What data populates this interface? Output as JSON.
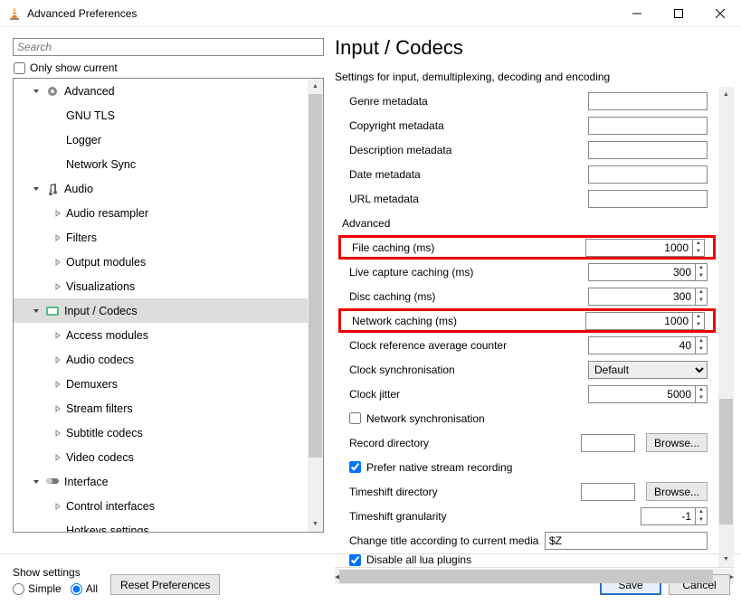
{
  "window": {
    "title": "Advanced Preferences"
  },
  "left": {
    "search_placeholder": "Search",
    "only_current": "Only show current",
    "tree": [
      {
        "kind": "group",
        "icon": "gear",
        "label": "Advanced",
        "expanded": true
      },
      {
        "kind": "child",
        "label": "GNU TLS"
      },
      {
        "kind": "child",
        "label": "Logger"
      },
      {
        "kind": "child",
        "label": "Network Sync"
      },
      {
        "kind": "group",
        "icon": "music",
        "label": "Audio",
        "expanded": true
      },
      {
        "kind": "childexp",
        "label": "Audio resampler"
      },
      {
        "kind": "childexp",
        "label": "Filters"
      },
      {
        "kind": "childexp",
        "label": "Output modules"
      },
      {
        "kind": "childexp",
        "label": "Visualizations"
      },
      {
        "kind": "group",
        "icon": "codec",
        "label": "Input / Codecs",
        "expanded": true,
        "selected": true
      },
      {
        "kind": "childexp",
        "label": "Access modules"
      },
      {
        "kind": "childexp",
        "label": "Audio codecs"
      },
      {
        "kind": "childexp",
        "label": "Demuxers"
      },
      {
        "kind": "childexp",
        "label": "Stream filters"
      },
      {
        "kind": "childexp",
        "label": "Subtitle codecs"
      },
      {
        "kind": "childexp",
        "label": "Video codecs"
      },
      {
        "kind": "group",
        "icon": "interface",
        "label": "Interface",
        "expanded": true
      },
      {
        "kind": "childexp",
        "label": "Control interfaces"
      },
      {
        "kind": "child",
        "label": "Hotkeys settings"
      }
    ]
  },
  "right": {
    "title": "Input / Codecs",
    "subtitle": "Settings for input, demultiplexing, decoding and encoding",
    "rows": [
      {
        "type": "text",
        "label": "Genre metadata",
        "value": ""
      },
      {
        "type": "text",
        "label": "Copyright metadata",
        "value": ""
      },
      {
        "type": "text",
        "label": "Description metadata",
        "value": ""
      },
      {
        "type": "text",
        "label": "Date metadata",
        "value": ""
      },
      {
        "type": "text",
        "label": "URL metadata",
        "value": ""
      },
      {
        "type": "section",
        "label": "Advanced"
      },
      {
        "type": "spin",
        "label": "File caching (ms)",
        "value": "1000",
        "highlight": true
      },
      {
        "type": "spin",
        "label": "Live capture caching (ms)",
        "value": "300"
      },
      {
        "type": "spin",
        "label": "Disc caching (ms)",
        "value": "300"
      },
      {
        "type": "spin",
        "label": "Network caching (ms)",
        "value": "1000",
        "highlight": true
      },
      {
        "type": "spin",
        "label": "Clock reference average counter",
        "value": "40"
      },
      {
        "type": "select",
        "label": "Clock synchronisation",
        "value": "Default"
      },
      {
        "type": "spin",
        "label": "Clock jitter",
        "value": "5000"
      },
      {
        "type": "check",
        "label": "Network synchronisation",
        "checked": false
      },
      {
        "type": "browse",
        "label": "Record directory",
        "value": "",
        "button": "Browse..."
      },
      {
        "type": "check",
        "label": "Prefer native stream recording",
        "checked": true
      },
      {
        "type": "browse",
        "label": "Timeshift directory",
        "value": "",
        "button": "Browse..."
      },
      {
        "type": "spin",
        "label": "Timeshift granularity",
        "value": "-1",
        "narrow": true
      },
      {
        "type": "textwide",
        "label": "Change title according to current media",
        "value": "$Z"
      },
      {
        "type": "check",
        "label": "Disable all lua plugins",
        "checked": true,
        "cut": true
      }
    ]
  },
  "footer": {
    "show_settings": "Show settings",
    "simple": "Simple",
    "all": "All",
    "reset": "Reset Preferences",
    "save": "Save",
    "cancel": "Cancel"
  }
}
